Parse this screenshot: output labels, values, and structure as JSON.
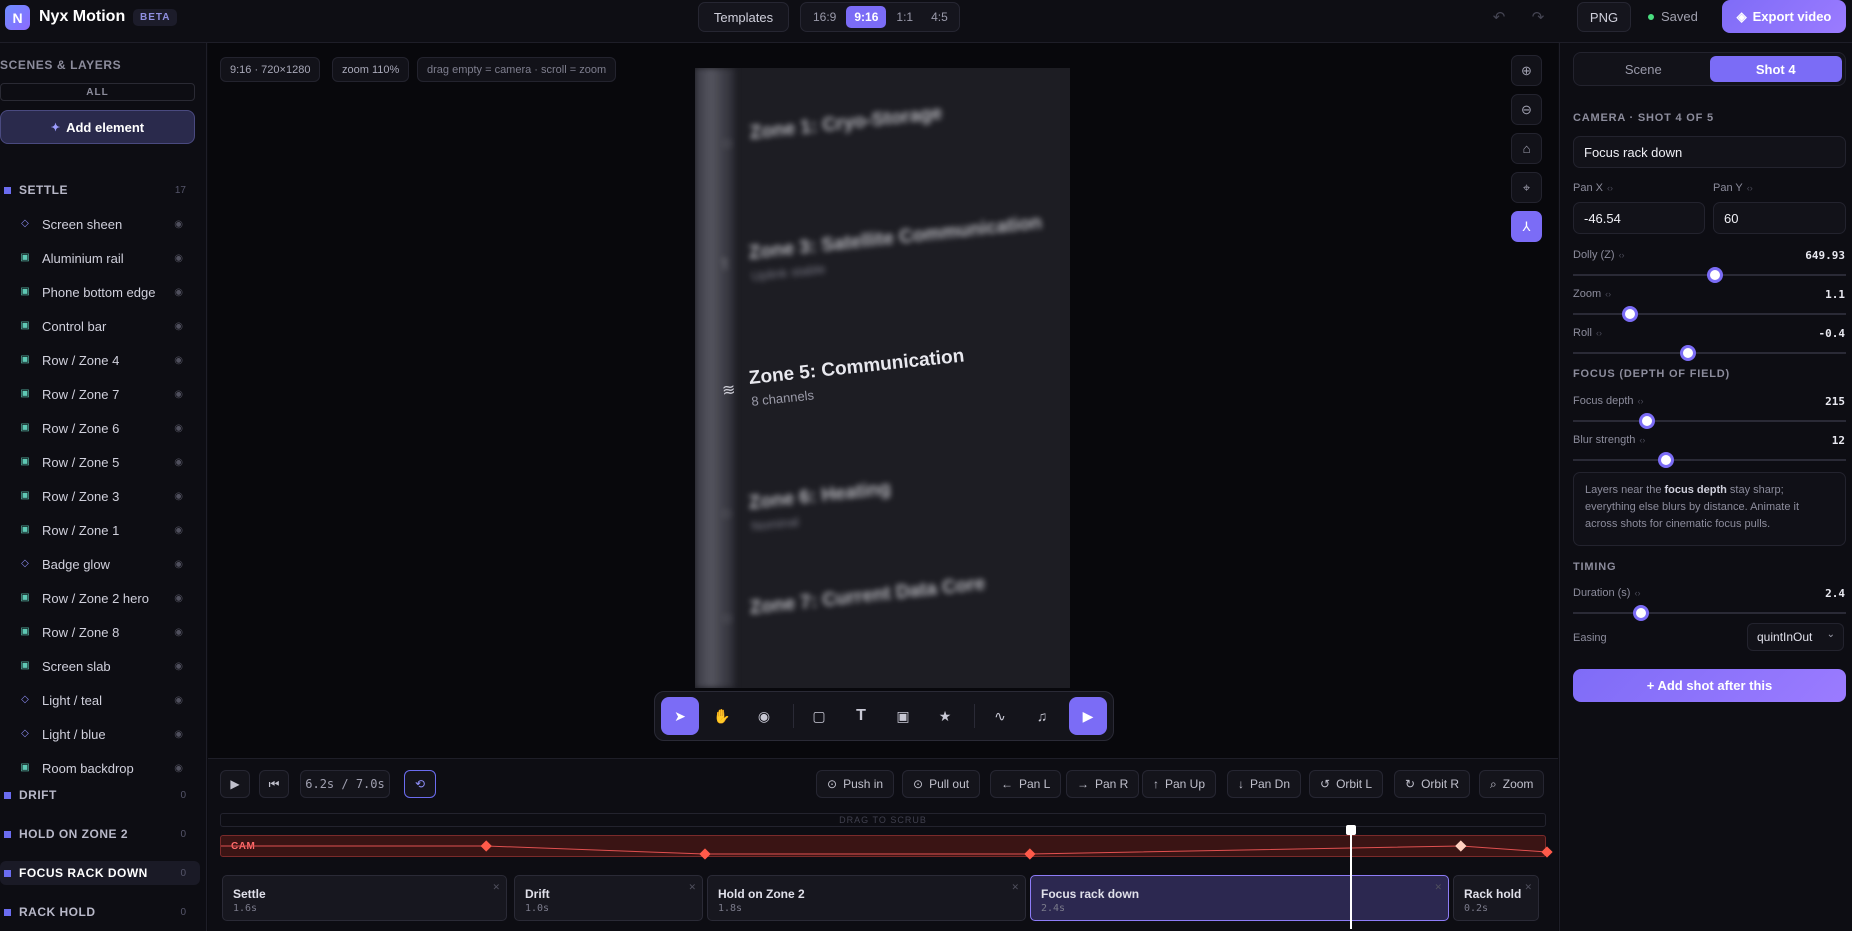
{
  "app": {
    "name": "Nyx Motion",
    "badge": "BETA",
    "logo_letter": "N"
  },
  "topbar": {
    "templates_label": "Templates",
    "ratios": [
      {
        "label": "16:9",
        "active": false
      },
      {
        "label": "9:16",
        "active": true
      },
      {
        "label": "1:1",
        "active": false
      },
      {
        "label": "4:5",
        "active": false
      }
    ],
    "format_label": "PNG",
    "status": "Saved",
    "export_label": "Export video"
  },
  "left": {
    "title": "SCENES & LAYERS",
    "filter_all": "ALL",
    "add_element": "Add element",
    "groups": [
      {
        "name": "SETTLE",
        "count": "17"
      },
      {
        "name": "DRIFT",
        "count": "0"
      },
      {
        "name": "HOLD ON ZONE 2",
        "count": "0"
      },
      {
        "name": "FOCUS RACK DOWN",
        "count": "0"
      },
      {
        "name": "RACK HOLD",
        "count": "0"
      }
    ],
    "layers": [
      {
        "name": "Screen sheen",
        "icon": "diamond-icon"
      },
      {
        "name": "Aluminium rail",
        "icon": "image-icon"
      },
      {
        "name": "Phone bottom edge",
        "icon": "image-icon"
      },
      {
        "name": "Control bar",
        "icon": "image-icon"
      },
      {
        "name": "Row / Zone 4",
        "icon": "image-icon"
      },
      {
        "name": "Row / Zone 7",
        "icon": "image-icon"
      },
      {
        "name": "Row / Zone 6",
        "icon": "image-icon"
      },
      {
        "name": "Row / Zone 5",
        "icon": "image-icon"
      },
      {
        "name": "Row / Zone 3",
        "icon": "image-icon"
      },
      {
        "name": "Row / Zone 1",
        "icon": "image-icon"
      },
      {
        "name": "Badge glow",
        "icon": "diamond-icon"
      },
      {
        "name": "Row / Zone 2 hero",
        "icon": "image-icon"
      },
      {
        "name": "Row / Zone 8",
        "icon": "image-icon"
      },
      {
        "name": "Screen slab",
        "icon": "image-icon"
      },
      {
        "name": "Light / teal",
        "icon": "diamond-icon"
      },
      {
        "name": "Light / blue",
        "icon": "diamond-icon"
      },
      {
        "name": "Room backdrop",
        "icon": "image-icon"
      }
    ]
  },
  "canvas": {
    "resolution": "9:16 · 720×1280",
    "zoom": "zoom 110%",
    "hint": "drag empty = camera · scroll = zoom",
    "zones": [
      {
        "title": "Zone 1: Cryo-Storage",
        "sub": ""
      },
      {
        "title": "Zone 3: Satellite Communication",
        "sub": "Uplink stable"
      },
      {
        "title": "Zone 5: Communication",
        "sub": "8 channels"
      },
      {
        "title": "Zone 6: Heating",
        "sub": "Nominal"
      },
      {
        "title": "Zone 7: Current Data Core",
        "sub": ""
      }
    ]
  },
  "timeline": {
    "time": "6.2s / 7.0s",
    "camera_moves": [
      "Push in",
      "Pull out",
      "Pan L",
      "Pan R",
      "Pan Up",
      "Pan Dn",
      "Orbit L",
      "Orbit R",
      "Zoom"
    ],
    "ruler_hint": "DRAG TO SCRUB",
    "cam_label": "CAM",
    "clips": [
      {
        "name": "Settle",
        "duration": "1.6s"
      },
      {
        "name": "Drift",
        "duration": "1.0s"
      },
      {
        "name": "Hold on Zone 2",
        "duration": "1.8s"
      },
      {
        "name": "Focus rack down",
        "duration": "2.4s"
      },
      {
        "name": "Rack hold",
        "duration": "0.2s"
      }
    ],
    "cam_keyframes": [
      0.2,
      0.365,
      0.61,
      0.935,
      1.0
    ]
  },
  "inspector": {
    "tabs": [
      {
        "label": "Scene",
        "active": false
      },
      {
        "label": "Shot 4",
        "active": true
      }
    ],
    "camera_header": "CAMERA · SHOT 4 OF 5",
    "shot_name": "Focus rack down",
    "pan_x_label": "Pan X",
    "pan_x": "-46.54",
    "pan_y_label": "Pan Y",
    "pan_y": "60",
    "sliders": [
      {
        "label": "Dolly (Z)",
        "value": "649.93",
        "fraction": 0.52
      },
      {
        "label": "Zoom",
        "value": "1.1",
        "fraction": 0.21
      },
      {
        "label": "Roll",
        "value": "-0.4",
        "fraction": 0.42
      }
    ],
    "focus_header": "FOCUS (DEPTH OF FIELD)",
    "focus_sliders": [
      {
        "label": "Focus depth",
        "value": "215",
        "fraction": 0.27
      },
      {
        "label": "Blur strength",
        "value": "12",
        "fraction": 0.34
      }
    ],
    "focus_note_pre": "Layers near the ",
    "focus_note_bold": "focus depth",
    "focus_note_post": " stay sharp; everything else blurs by distance. Animate it across shots for cinematic focus pulls.",
    "timing_header": "TIMING",
    "duration_label": "Duration (s)",
    "duration_value": "2.4",
    "duration_fraction": 0.25,
    "easing_label": "Easing",
    "easing_value": "quintInOut",
    "add_shot": "+ Add shot after this"
  }
}
